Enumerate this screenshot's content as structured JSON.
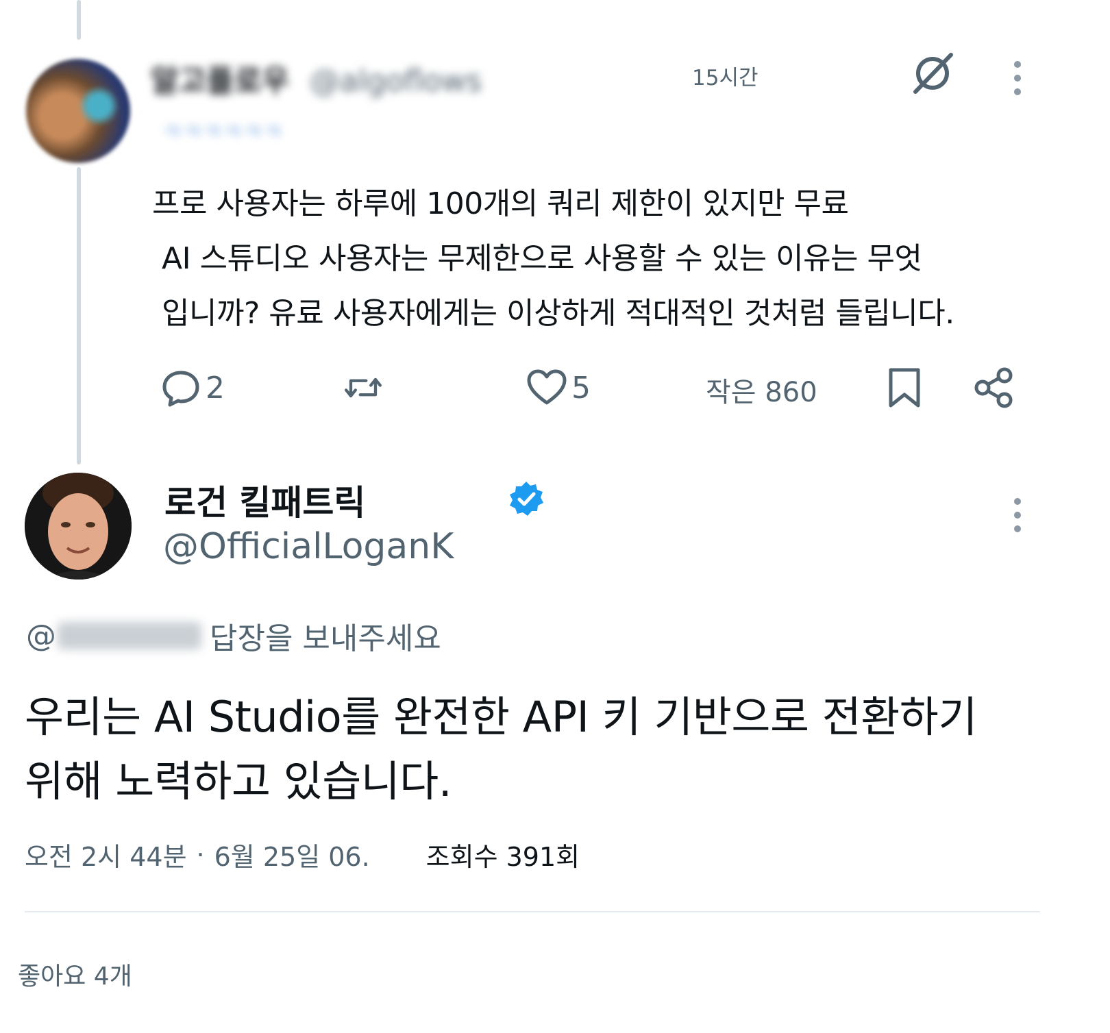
{
  "parent_tweet": {
    "display_name": "알고플로우",
    "handle": "@algoflows",
    "subline": "ㅋㅋㅋㅋㅋㅋ",
    "time": "15시간",
    "lines": [
      "프로 사용자는 하루에 100개의 쿼리 제한이 있지만 무료",
      "AI 스튜디오 사용자는 무제한으로 사용할 수 있는 이유는 무엇",
      "입니까? 유료 사용자에게는 이상하게 적대적인 것처럼 들립니다."
    ],
    "actions": {
      "replies": "2",
      "likes": "5",
      "views": "작은 860"
    }
  },
  "reply_tweet": {
    "display_name": "로건 킬패트릭",
    "handle": "@OfficialLoganK",
    "reply_to_prefix": "@",
    "reply_to_suffix": "답장을 보내주세요",
    "lines": [
      "우리는 AI Studio를 완전한 API 키 기반으로 전환하기",
      "위해 노력하고 있습니다."
    ],
    "time": "오전 2시 44분",
    "dot": "·",
    "date": "6월 25일 06.",
    "views": "조회수 391회",
    "likes_count": "좋아요 4개"
  },
  "colors": {
    "text": "#0f1419",
    "secondary": "#536471",
    "verified": "#1d9bf0",
    "thread_line": "#cfd9de"
  }
}
